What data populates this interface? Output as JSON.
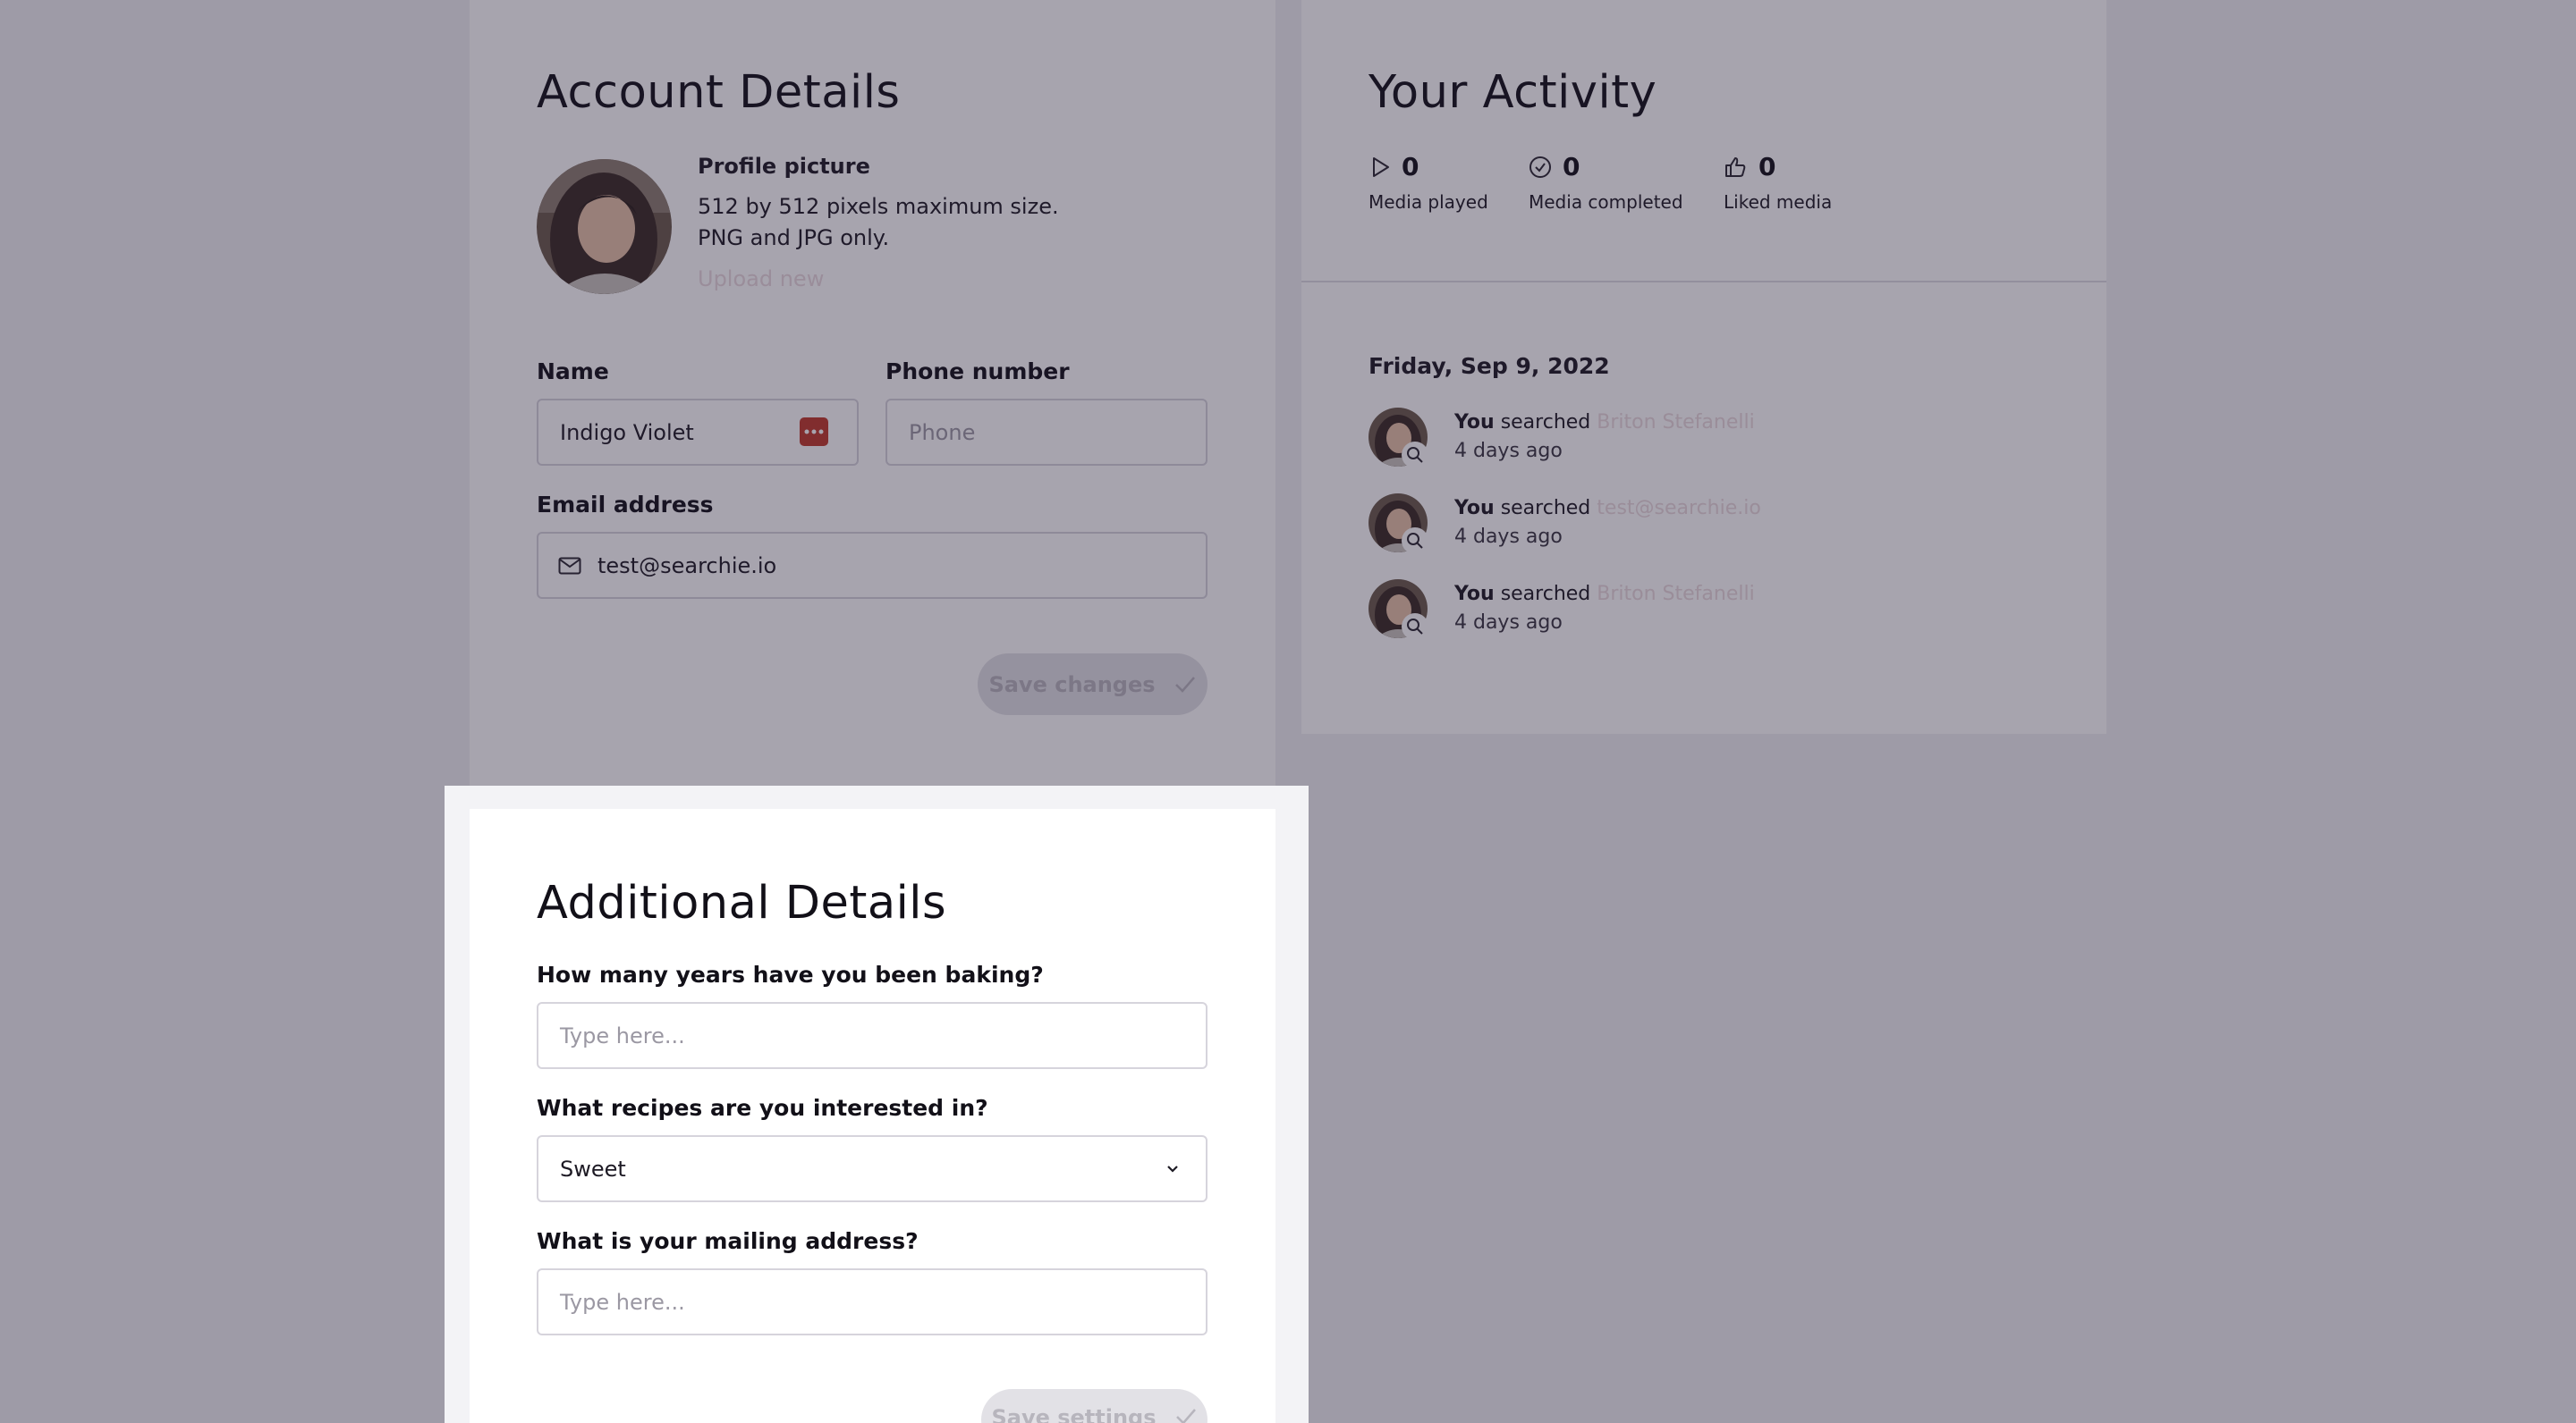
{
  "colors": {
    "background": "#f1f1f4",
    "card": "#ffffff",
    "overlay": "#221b34",
    "button_disabled_bg": "#e2e1e6",
    "button_disabled_text": "#b7b5bd",
    "password_manager_badge": "#c0392b"
  },
  "account": {
    "title": "Account Details",
    "profile_picture_label": "Profile picture",
    "profile_hint_line1": "512 by 512 pixels maximum size.",
    "profile_hint_line2": "PNG and JPG only.",
    "upload_link": "Upload new",
    "name_label": "Name",
    "name_value": "Indigo Violet",
    "phone_label": "Phone number",
    "phone_placeholder": "Phone",
    "email_label": "Email address",
    "email_value": "test@searchie.io",
    "save_button": "Save changes",
    "icons": {
      "password_manager": "key-dots-icon",
      "email": "mail-icon",
      "save": "check-icon"
    }
  },
  "activity": {
    "title": "Your Activity",
    "stats": [
      {
        "icon": "play-icon",
        "value": "0",
        "label": "Media played"
      },
      {
        "icon": "check-circle-icon",
        "value": "0",
        "label": "Media completed"
      },
      {
        "icon": "thumbs-up-icon",
        "value": "0",
        "label": "Liked media"
      }
    ],
    "date": "Friday, Sep 9, 2022",
    "items": [
      {
        "who": "You",
        "action": "searched",
        "query": "Briton Stefanelli",
        "time": "4 days ago",
        "badge_icon": "search-icon"
      },
      {
        "who": "You",
        "action": "searched",
        "query": "test@searchie.io",
        "time": "4 days ago",
        "badge_icon": "search-icon"
      },
      {
        "who": "You",
        "action": "searched",
        "query": "Briton Stefanelli",
        "time": "4 days ago",
        "badge_icon": "search-icon"
      }
    ]
  },
  "additional": {
    "title": "Additional Details",
    "q1_label": "How many years have you been baking?",
    "q1_placeholder": "Type here...",
    "q2_label": "What recipes are you interested in?",
    "q2_value": "Sweet",
    "q3_label": "What is your mailing address?",
    "q3_placeholder": "Type here...",
    "save_button": "Save settings",
    "icons": {
      "select": "chevron-down-icon",
      "save": "check-icon"
    }
  }
}
